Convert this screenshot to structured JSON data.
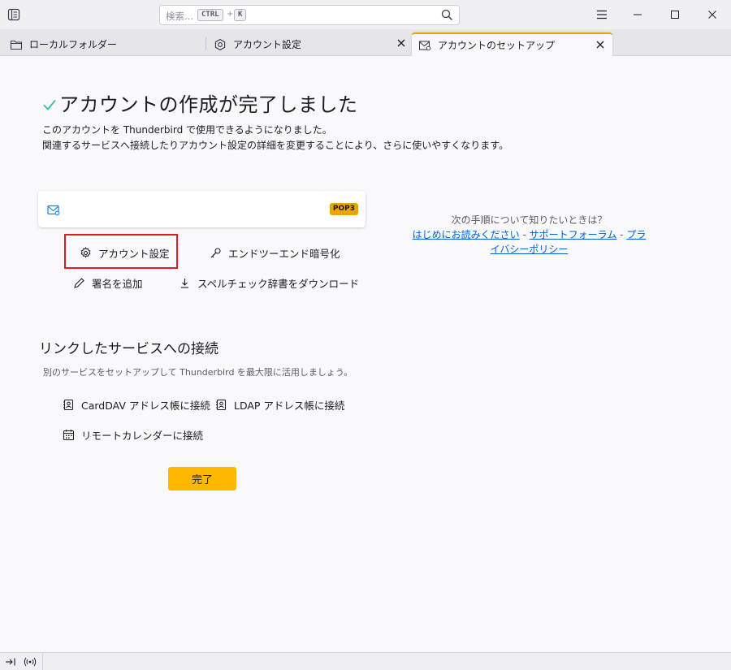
{
  "search": {
    "placeholder": "検索...",
    "shortcut_modifier": "CTRL",
    "shortcut_plus": "+",
    "shortcut_key": "K"
  },
  "tabs": [
    {
      "label": "ローカルフォルダー",
      "icon": "folder-icon",
      "selected": false
    },
    {
      "label": "アカウント設定",
      "icon": "settings-cog-icon",
      "selected": false
    },
    {
      "label": "アカウントのセットアップ",
      "icon": "mail-setup-icon",
      "selected": true
    }
  ],
  "main": {
    "headline": "アカウントの作成が完了しました",
    "intro_line1": "このアカウントを Thunderbird で使用できるようになりました。",
    "intro_line2": "関連するサービスへ接続したりアカウント設定の詳細を変更することにより、さらに使いやすくなります。",
    "account_badge": "POP3",
    "actions": {
      "account_settings": "アカウント設定",
      "e2ee": "エンドツーエンド暗号化",
      "add_signature": "署名を追加",
      "download_dictionary": "スペルチェック辞書をダウンロード"
    },
    "help": {
      "question": "次の手順について知りたいときは？",
      "link_readme": "はじめにお読みください",
      "separator": "-",
      "link_forum": "サポートフォーラム",
      "link_privacy": "プライバシーポリシー"
    },
    "linked_services": {
      "title": "リンクしたサービスへの接続",
      "description": "別のサービスをセットアップして Thunderbird を最大限に活用しましょう。",
      "carddav": "CardDAV アドレス帳に接続",
      "ldap": "LDAP アドレス帳に接続",
      "calendar": "リモートカレンダーに接続"
    },
    "done_button": "完了"
  },
  "colors": {
    "accent": "#e7a500",
    "done_button": "#ffb800",
    "link": "#0061e0",
    "check": "#2ac3a2",
    "highlight": "#e31b23"
  }
}
